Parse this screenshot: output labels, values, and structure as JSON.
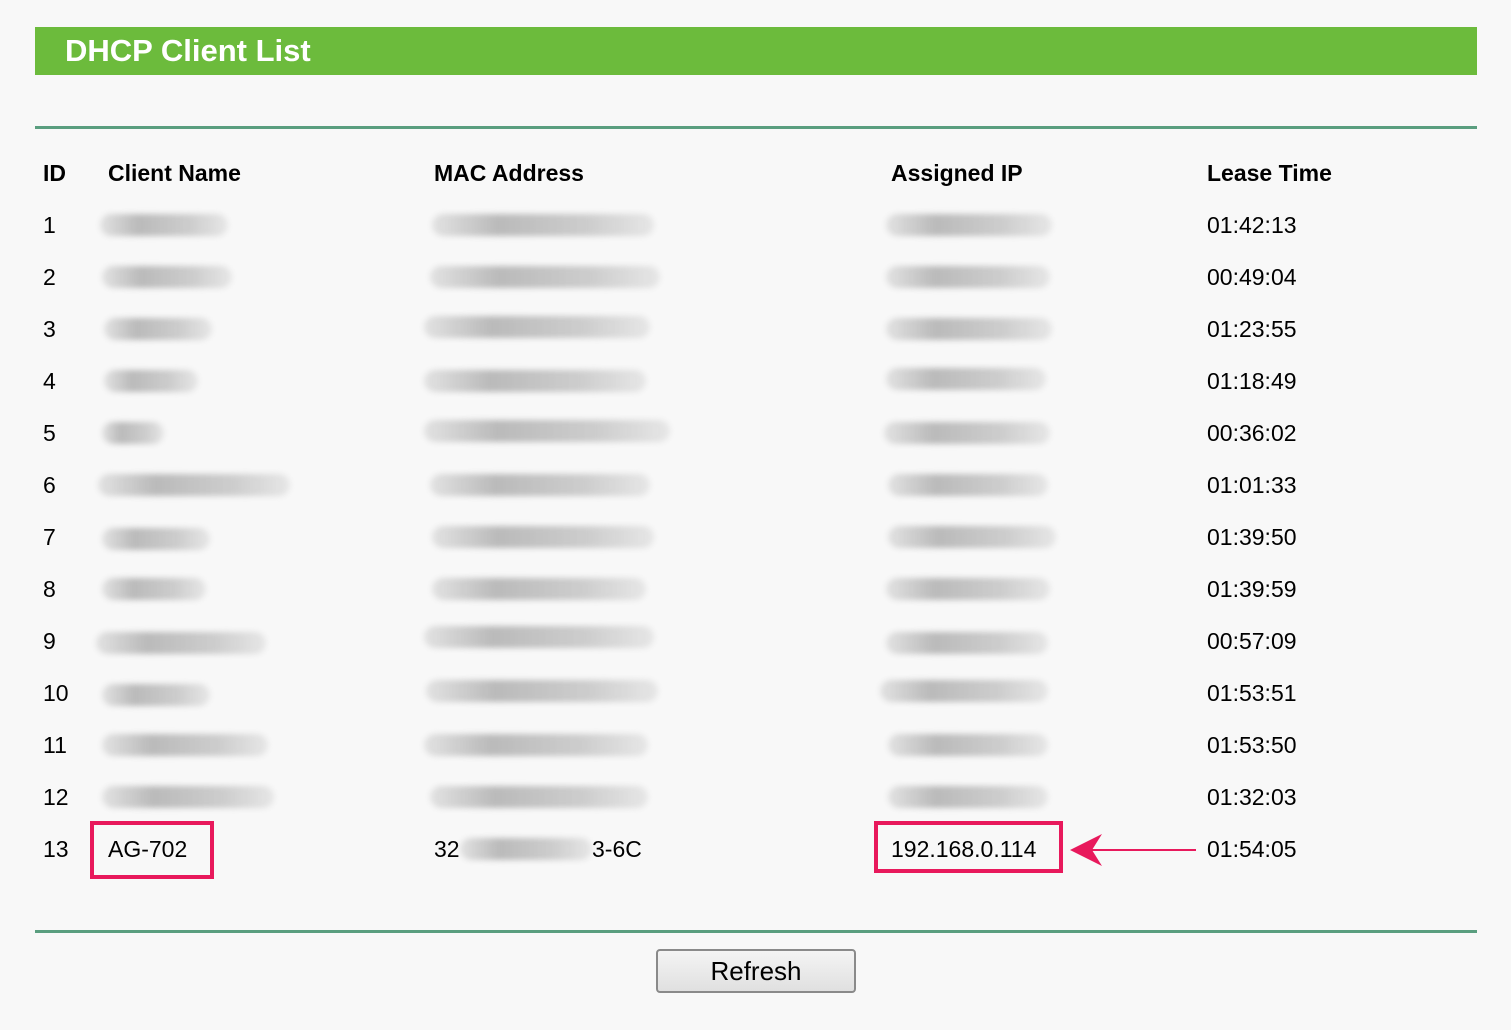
{
  "title": "DHCP Client List",
  "columns": {
    "id": "ID",
    "client_name": "Client Name",
    "mac_address": "MAC Address",
    "assigned_ip": "Assigned IP",
    "lease_time": "Lease Time"
  },
  "rows": [
    {
      "id": "1",
      "lease_time": "01:42:13"
    },
    {
      "id": "2",
      "lease_time": "00:49:04"
    },
    {
      "id": "3",
      "lease_time": "01:23:55"
    },
    {
      "id": "4",
      "lease_time": "01:18:49"
    },
    {
      "id": "5",
      "lease_time": "00:36:02"
    },
    {
      "id": "6",
      "lease_time": "01:01:33"
    },
    {
      "id": "7",
      "lease_time": "01:39:50"
    },
    {
      "id": "8",
      "lease_time": "01:39:59"
    },
    {
      "id": "9",
      "lease_time": "00:57:09"
    },
    {
      "id": "10",
      "lease_time": "01:53:51"
    },
    {
      "id": "11",
      "lease_time": "01:53:50"
    },
    {
      "id": "12",
      "lease_time": "01:32:03"
    },
    {
      "id": "13",
      "client_name": "AG-702",
      "mac_prefix": "32",
      "mac_suffix": "3-6C",
      "assigned_ip": "192.168.0.114",
      "lease_time": "01:54:05"
    }
  ],
  "refresh_label": "Refresh",
  "colors": {
    "title_bar": "#6cbb3c",
    "rule": "#5a9e7f",
    "highlight": "#e8195c"
  }
}
